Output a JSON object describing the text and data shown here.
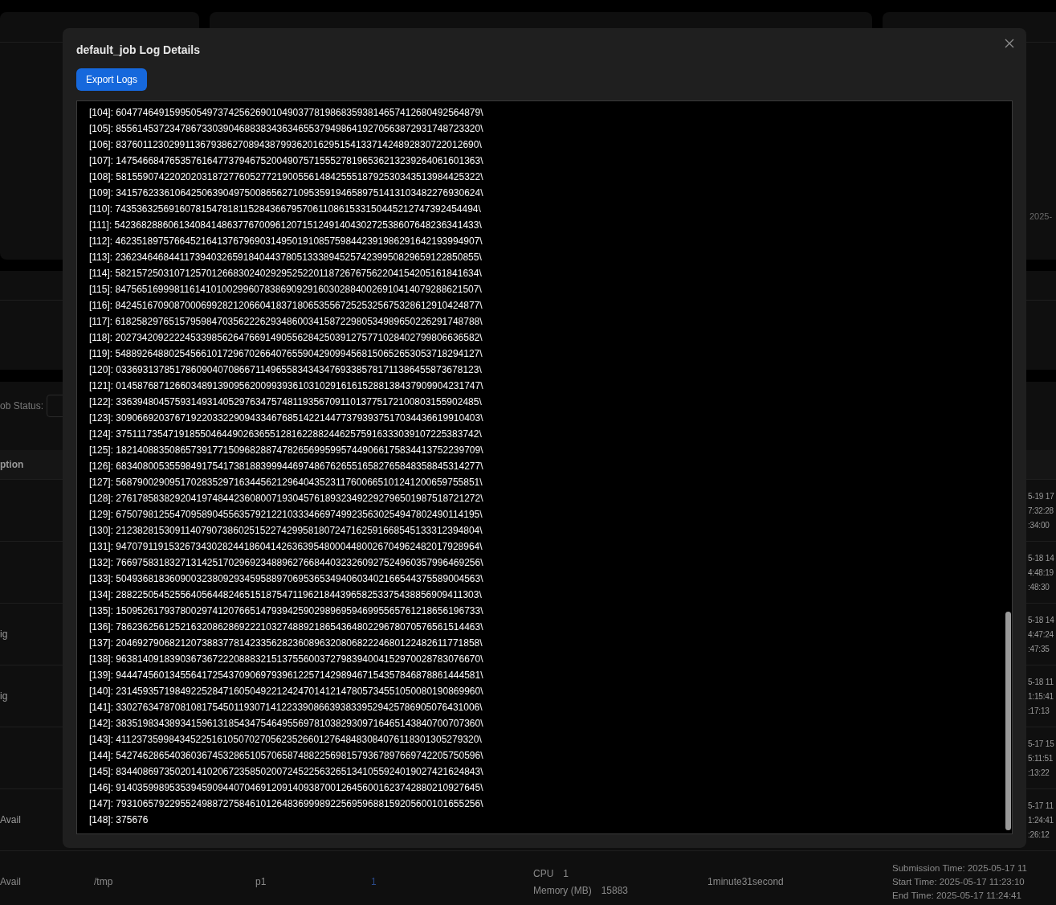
{
  "background": {
    "axis_label": "2025-",
    "filter": {
      "label": "ob Status:"
    },
    "table": {
      "header": "ption",
      "rows": [
        {
          "column_1": "",
          "times": [
            "5-19 17",
            "7:32:28",
            ":34:00"
          ]
        },
        {
          "column_1": "",
          "times": [
            "5-18 14",
            "4:48:19",
            ":48:30"
          ]
        },
        {
          "column_1": "ig",
          "times": [
            "5-18 14",
            "4:47:24",
            ":47:35"
          ]
        },
        {
          "column_1": "ig",
          "times": [
            "5-18 11",
            "1:15:41",
            ":17:13"
          ]
        },
        {
          "column_1": "",
          "times": [
            "5-17 15",
            "5:11:51",
            ":13:22"
          ]
        },
        {
          "column_1": "Avail",
          "times": [
            "5-17 11",
            "1:24:41",
            ":26:12"
          ]
        }
      ],
      "last_row": {
        "column_1": "Avail",
        "column_2": "/tmp",
        "column_3": "p1",
        "column_4": "1",
        "resources": [
          {
            "label": "CPU",
            "value": "1"
          },
          {
            "label": "Memory (MB)",
            "value": "15883"
          }
        ],
        "duration": "1minute31second",
        "times": [
          "Submission Time: 2025-05-17 11",
          "Start Time: 2025-05-17 11:23:10",
          "End Time: 2025-05-17 11:24:41"
        ]
      }
    }
  },
  "dialog": {
    "title": "default_job Log Details",
    "export_button": "Export Logs",
    "log_lines": [
      "[104]: 60477464915995054973742562690104903778198683593814657412680492564879\\",
      "[105]: 85561453723478673303904688383436346553794986419270563872931748723320\\",
      "[106]: 83760112302991136793862708943879936201629515413371424892830722012690\\",
      "[107]: 14754668476535761647737946752004907571555278196536213239264061601363\\",
      "[108]: 58155907422020203187277605277219005561484255518792530343513984425322\\",
      "[109]: 34157623361064250639049750086562710953591946589751413103482276930624\\",
      "[110]: 74353632569160781547818115284366795706110861533150445212747392454494\\",
      "[111]: 54236828860613408414863776700961207151249140430272538607648236341433\\",
      "[112]: 46235189757664521641376796903149501910857598442391986291642193994907\\",
      "[113]: 23623464684411739403265918404437805133389452574239950829659122850855\\",
      "[114]: 58215725031071257012668302402929525220118726767562204154205161841634\\",
      "[115]: 84756516999811614101002996078386909291603028840026910414079288621507\\",
      "[116]: 84245167090870006992821206604183718065355672525325675328612910424877\\",
      "[117]: 61825829765157959847035622262934860034158722980534989650226291748788\\",
      "[118]: 20273420922224533985626476691490556284250391275771028402799806636582\\",
      "[119]: 54889264880254566101729670266407655904290994568150652653053718294127\\",
      "[120]: 03369313785178609040708667114965583434347693385781711386455873678123\\",
      "[121]: 01458768712660348913909562009939361031029161615288138437909904231747\\",
      "[122]: 33639480457593149314052976347574811935670911013775172100803155902485\\",
      "[123]: 30906692037671922033229094334676851422144773793937517034436619910403\\",
      "[124]: 37511173547191855046449026365512816228824462575916333039107225383742\\",
      "[125]: 18214088350865739177150968288747826569959957449066175834413752239709\\",
      "[126]: 68340800535598491754173818839994469748676265516582765848358845314277\\",
      "[127]: 56879002909517028352971634456212964043523117600665101241200659755851\\",
      "[128]: 27617858382920419748442360800719304576189323492292796501987518721272\\",
      "[129]: 67507981255470958904556357921221033346697499235630254947802490114195\\",
      "[130]: 21238281530911407907386025152274299581807247162591668545133312394804\\",
      "[131]: 94707911915326734302824418604142636395480004480026704962482017928964\\",
      "[132]: 76697583183271314251702969234889627668440323260927524960357996469256\\",
      "[133]: 50493681836090032380929345958897069536534940603402166544375589004563\\",
      "[134]: 28822505452556405644824651518754711962184439658253375438856909411303\\",
      "[135]: 15095261793780029741207665147939425902989695946995565761218656196733\\",
      "[136]: 78623625612521632086286922210327488921865436480229678070576561514463\\",
      "[137]: 20469279068212073883778142335628236089632080682224680122482611771858\\",
      "[138]: 96381409183903673672220888321513755600372798394004152970028783076670\\",
      "[139]: 94447456013455641725437090697939612257142989467154357846878861444581\\",
      "[140]: 23145935719849225284716050492212424701412147805734551050080190869960\\",
      "[141]: 33027634787081081754501193071412233908663938339529425786905076431006\\",
      "[142]: 38351983438934159613185434754649556978103829309716465143840700707360\\",
      "[143]: 41123735998434522516105070270562352660127648483084076118301305279320\\",
      "[144]: 54274628654036036745328651057065874882256981579367897669742205750596\\",
      "[145]: 83440869735020141020672358502007245225632651341055924019027421624843\\",
      "[146]: 91403599895353945909440704691209140938700126456001623742880210927645\\",
      "[147]: 79310657922955249887275846101264836999892256959688159205600101655256\\",
      "[148]: 375676"
    ]
  }
}
